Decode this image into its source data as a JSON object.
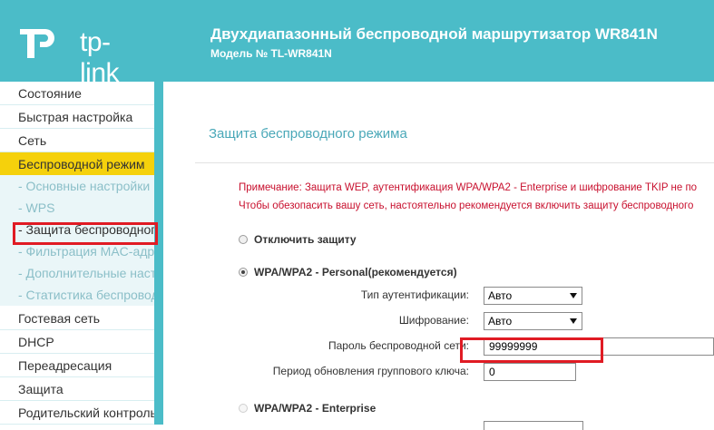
{
  "header": {
    "brand": "tp-link",
    "title": "Двухдиапазонный беспроводной маршрутизатор WR841N",
    "model": "Модель № TL-WR841N",
    "color": "#4bbcc8"
  },
  "sidebar": {
    "items": [
      {
        "label": "Состояние"
      },
      {
        "label": "Быстрая настройка"
      },
      {
        "label": "Сеть"
      },
      {
        "label": "Беспроводной режим",
        "active": true
      },
      {
        "label": "Гостевая сеть"
      },
      {
        "label": "DHCP"
      },
      {
        "label": "Переадресация"
      },
      {
        "label": "Защита"
      },
      {
        "label": "Родительский контроль"
      }
    ],
    "subitems": [
      {
        "label": "- Основные настройки"
      },
      {
        "label": "- WPS"
      },
      {
        "label": "- Защита беспроводного режима",
        "current": true
      },
      {
        "label": "- Фильтрация MAC-адресов"
      },
      {
        "label": "- Дополнительные настройки"
      },
      {
        "label": "- Статистика беспроводного режима"
      }
    ],
    "active_color": "#f5d10c"
  },
  "main": {
    "title": "Защита беспроводного режима",
    "note_line1": "Примечание: Защита WEP, аутентификация WPA/WPA2 - Enterprise и шифрование TKIP не по",
    "note_line2": "Чтобы обезопасить вашу сеть, настоятельно рекомендуется включить защиту беспроводного",
    "options": {
      "disable": "Отключить защиту",
      "personal": "WPA/WPA2 - Personal(рекомендуется)",
      "enterprise": "WPA/WPA2 - Enterprise"
    },
    "fields": {
      "auth_label": "Тип аутентификации:",
      "auth_value": "Авто",
      "enc_label": "Шифрование:",
      "enc_value": "Авто",
      "password_label": "Пароль беспроводной сети:",
      "password_value": "99999999",
      "rekey_label": "Период обновления группового ключа:",
      "rekey_value": "0"
    }
  },
  "highlight_color": "#e01b24"
}
